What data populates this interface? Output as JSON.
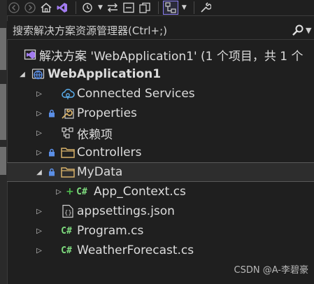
{
  "toolbar": {
    "buttons": [
      "back-icon",
      "forward-icon",
      "home-icon",
      "vs-icon",
      "history-icon",
      "sync-icon",
      "collapse-icon",
      "pages-icon",
      "scope-icon",
      "properties-wrench-icon"
    ]
  },
  "search": {
    "placeholder": "搜索解决方案资源管理器(Ctrl+;)"
  },
  "solution": {
    "label": "解决方案 'WebApplication1' (1 个项目，共 1 个"
  },
  "project": {
    "label": "WebApplication1"
  },
  "items": [
    {
      "label": "Connected Services",
      "icon": "cloud-icon"
    },
    {
      "label": "Properties",
      "icon": "wrench-icon"
    },
    {
      "label": "依赖项",
      "icon": "dependencies-icon"
    },
    {
      "label": "Controllers",
      "icon": "folder-icon"
    },
    {
      "label": "MyData",
      "icon": "folder-icon"
    },
    {
      "label": "App_Context.cs",
      "icon": "csharp-file-icon"
    },
    {
      "label": "appsettings.json",
      "icon": "json-file-icon"
    },
    {
      "label": "Program.cs",
      "icon": "csharp-file-icon"
    },
    {
      "label": "WeatherForecast.cs",
      "icon": "csharp-file-icon"
    }
  ],
  "watermark": "CSDN @A-李碧豪",
  "colors": {
    "background": "#1f1f1f",
    "accent": "#8a7ef0",
    "csharp": "#7fdc7f",
    "lock": "#5b8fe6",
    "folder": "#d8b26a"
  }
}
